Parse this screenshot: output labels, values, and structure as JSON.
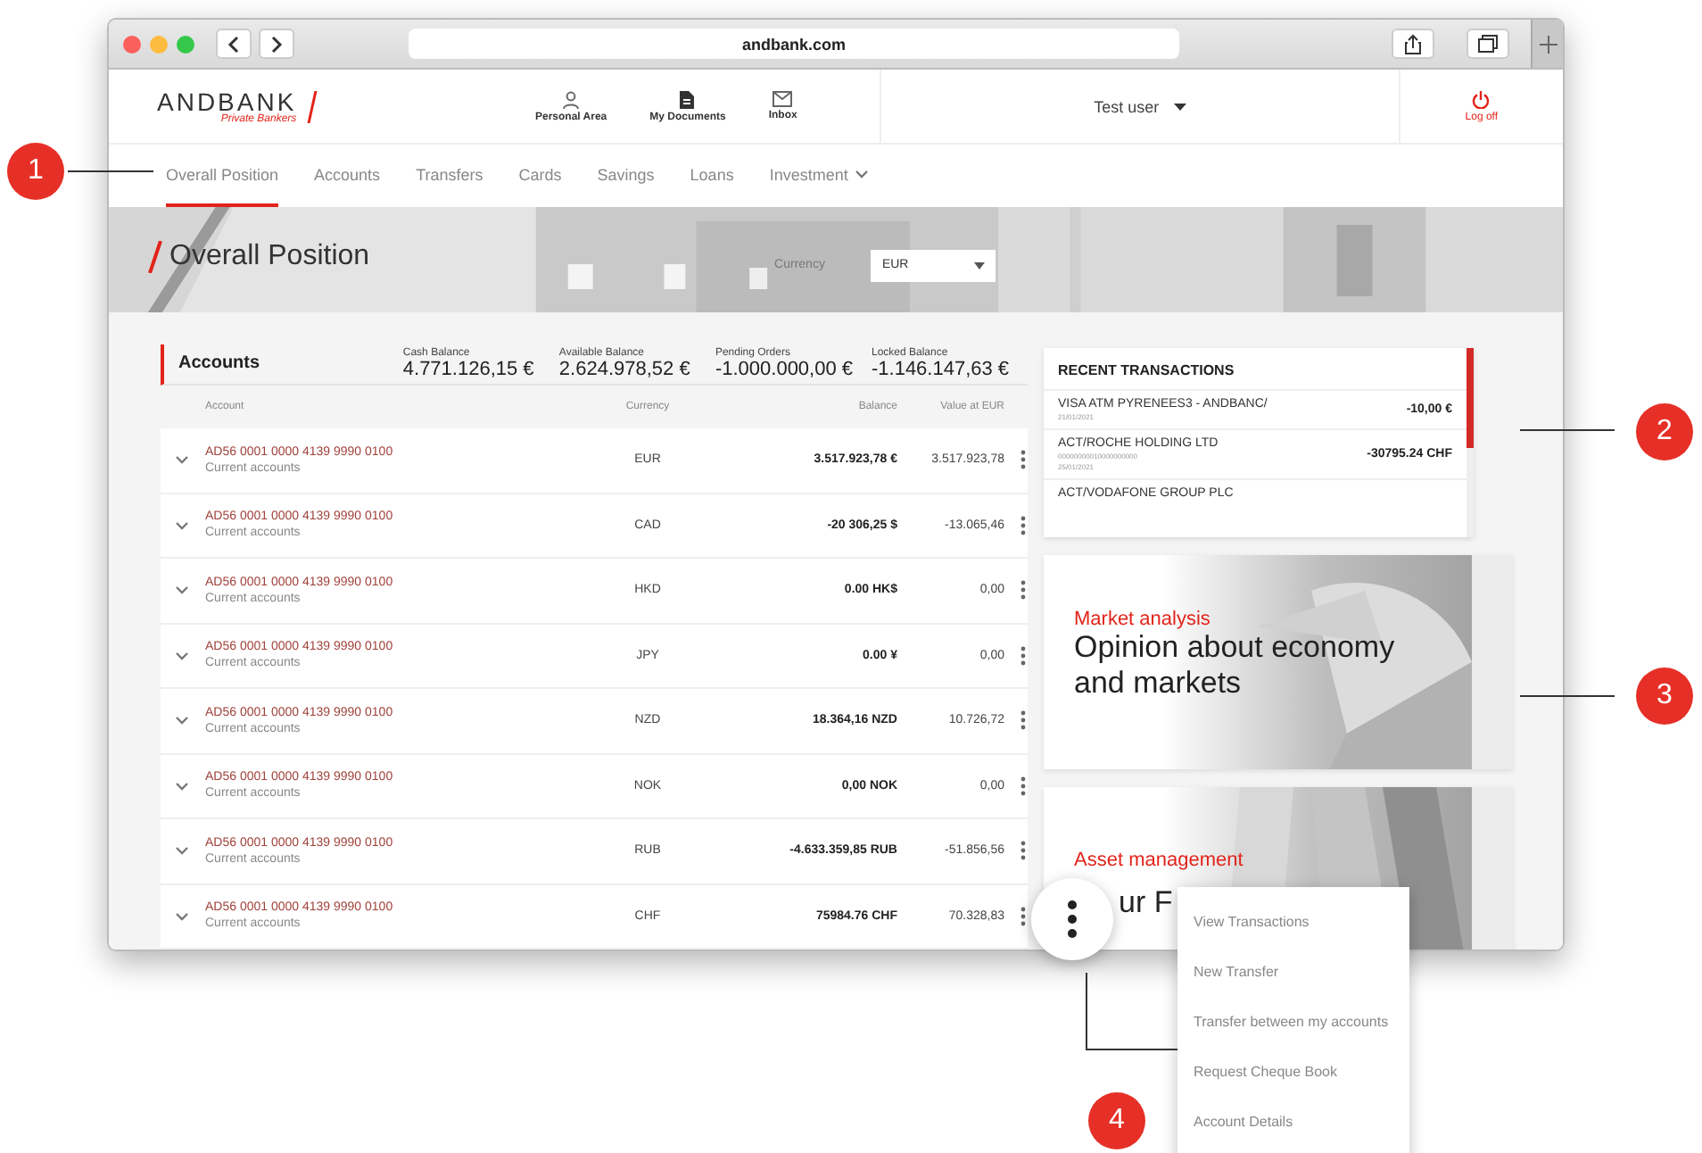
{
  "browser": {
    "url": "andbank.com"
  },
  "header": {
    "logo": "ANDBANK",
    "tagline": "Private Bankers",
    "shortcuts": [
      {
        "label": "Personal Area"
      },
      {
        "label": "My Documents"
      },
      {
        "label": "Inbox"
      }
    ],
    "user": "Test user",
    "logout": "Log off"
  },
  "nav": [
    {
      "label": "Overall Position",
      "selected": true,
      "kind": "link"
    },
    {
      "label": "Accounts",
      "selected": false,
      "kind": "link"
    },
    {
      "label": "Transfers",
      "selected": false,
      "kind": "link"
    },
    {
      "label": "Cards",
      "selected": false,
      "kind": "link"
    },
    {
      "label": "Savings",
      "selected": false,
      "kind": "link"
    },
    {
      "label": "Loans",
      "selected": false,
      "kind": "link"
    },
    {
      "label": "Investment",
      "selected": false,
      "kind": "dropdown"
    }
  ],
  "hero": {
    "title": "Overall Position",
    "currency_label": "Currency",
    "currency_value": "EUR"
  },
  "accounts": {
    "title": "Accounts",
    "summaries": [
      {
        "label": "Cash Balance",
        "value": "4.771.126,15 €"
      },
      {
        "label": "Available Balance",
        "value": "2.624.978,52 €"
      },
      {
        "label": "Pending Orders",
        "value": "-1.000.000,00 €"
      },
      {
        "label": "Locked Balance",
        "value": "-1.146.147,63 €"
      }
    ],
    "columns": [
      "Account",
      "Currency",
      "Balance",
      "Value at EUR"
    ],
    "rows": [
      {
        "account": "AD56 0001 0000 4139 9990 0100",
        "type": "Current accounts",
        "currency": "EUR",
        "balance": "3.517.923,78 €",
        "value": "3.517.923,78"
      },
      {
        "account": "AD56 0001 0000 4139 9990 0100",
        "type": "Current accounts",
        "currency": "CAD",
        "balance": "-20 306,25 $",
        "value": "-13.065,46"
      },
      {
        "account": "AD56 0001 0000 4139 9990 0100",
        "type": "Current accounts",
        "currency": "HKD",
        "balance": "0.00 HK$",
        "value": "0,00"
      },
      {
        "account": "AD56 0001 0000 4139 9990 0100",
        "type": "Current accounts",
        "currency": "JPY",
        "balance": "0.00 ¥",
        "value": "0,00"
      },
      {
        "account": "AD56 0001 0000 4139 9990 0100",
        "type": "Current accounts",
        "currency": "NZD",
        "balance": "18.364,16 NZD",
        "value": "10.726,72"
      },
      {
        "account": "AD56 0001 0000 4139 9990 0100",
        "type": "Current accounts",
        "currency": "NOK",
        "balance": "0,00 NOK",
        "value": "0,00"
      },
      {
        "account": "AD56 0001 0000 4139 9990 0100",
        "type": "Current accounts",
        "currency": "RUB",
        "balance": "-4.633.359,85 RUB",
        "value": "-51.856,56"
      },
      {
        "account": "AD56 0001 0000 4139 9990 0100",
        "type": "Current accounts",
        "currency": "CHF",
        "balance": "75984.76 CHF",
        "value": "70.328,83"
      }
    ]
  },
  "recent_transactions": {
    "title": "RECENT TRANSACTIONS",
    "items": [
      {
        "description": "VISA ATM PYRENEES3 - ANDBANC/",
        "date": "21/01/2021",
        "amount": "-10,00 €"
      },
      {
        "description": "ACT/ROCHE HOLDING LTD",
        "reference": "00000000010000000000",
        "date": "25/01/2021",
        "amount": "-30795.24 CHF"
      },
      {
        "description": "ACT/VODAFONE GROUP PLC"
      }
    ]
  },
  "promos": [
    {
      "category": "Market analysis",
      "title": "Opinion about economy and markets"
    },
    {
      "category": "Asset management",
      "title": "ur F"
    }
  ],
  "row_menu": [
    "View Transactions",
    "New Transfer",
    "Transfer between my accounts",
    "Request Cheque Book",
    "Account Details"
  ],
  "callouts": [
    "1",
    "2",
    "3",
    "4"
  ]
}
